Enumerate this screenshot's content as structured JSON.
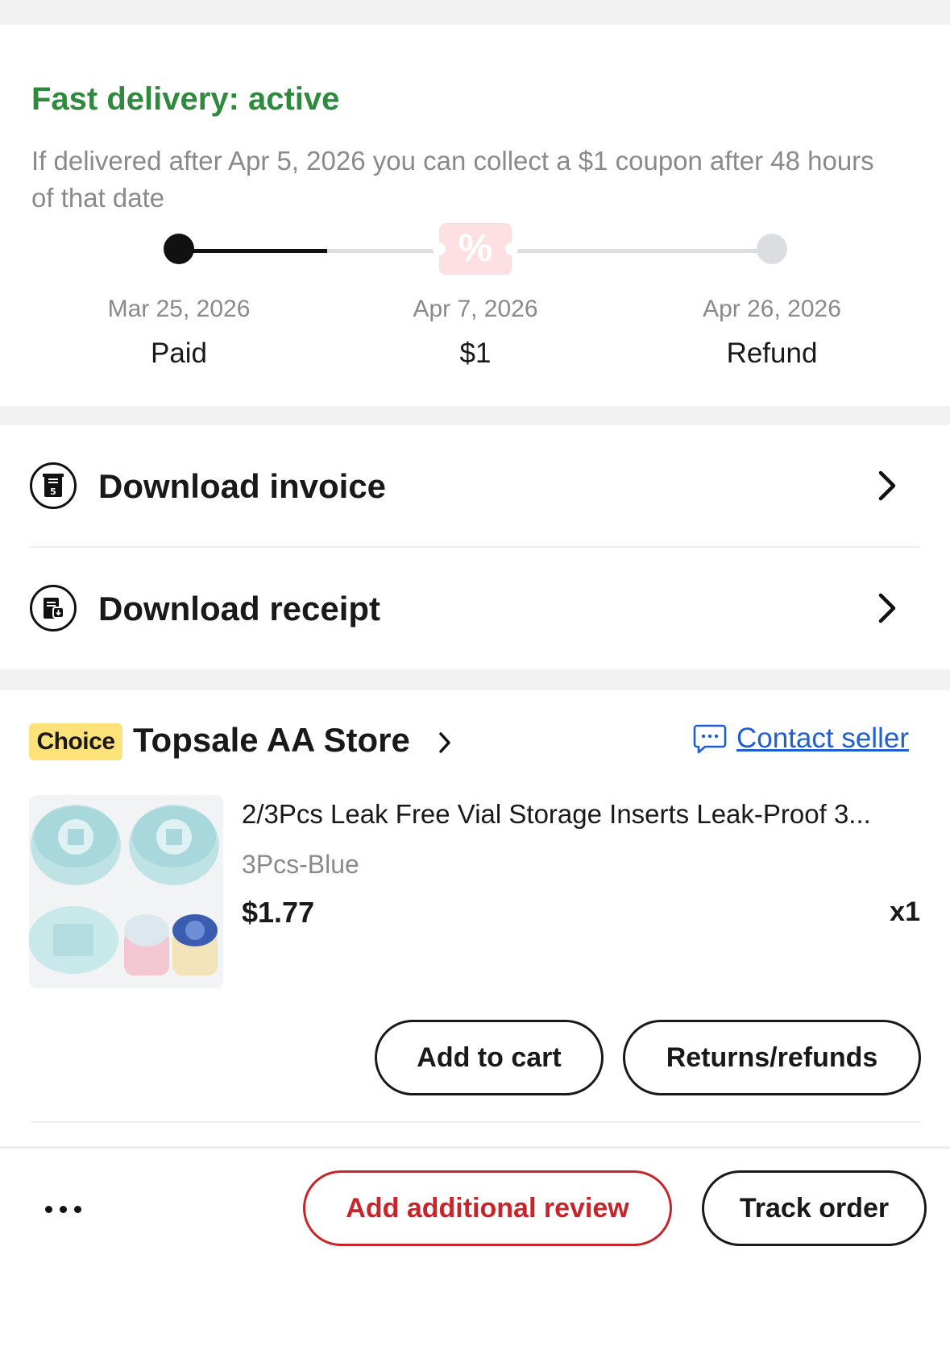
{
  "fast_delivery": {
    "title": "Fast delivery: active",
    "description": "If delivered after Apr 5, 2026 you can collect a $1 coupon after 48 hours of that date",
    "progress_fraction": 0.25,
    "colors": {
      "title": "#2e8b3e",
      "track_done": "#111111",
      "track_pending": "#dcdde0",
      "coupon_bg": "#fde0e2"
    },
    "milestones": [
      {
        "date": "Mar 25, 2026",
        "label": "Paid"
      },
      {
        "date": "Apr 7, 2026",
        "label": "$1",
        "icon": "percent-coupon-icon"
      },
      {
        "date": "Apr 26, 2026",
        "label": "Refund"
      }
    ]
  },
  "downloads": [
    {
      "label": "Download invoice",
      "icon": "invoice-icon"
    },
    {
      "label": "Download receipt",
      "icon": "receipt-icon"
    }
  ],
  "store": {
    "badge": "Choice",
    "name": "Topsale AA Store",
    "contact_label": "Contact seller",
    "contact_icon": "chat-icon",
    "accent_link": "#1f5fd6"
  },
  "product": {
    "title": "2/3Pcs Leak Free Vial Storage Inserts Leak-Proof 3...",
    "variant": "3Pcs-Blue",
    "price": "$1.77",
    "quantity": "x1",
    "actions": {
      "add_to_cart": "Add to cart",
      "returns": "Returns/refunds"
    }
  },
  "bottom_bar": {
    "more_icon": "more-dots-icon",
    "review_label": "Add additional review",
    "track_label": "Track order",
    "review_color": "#c7252c"
  }
}
